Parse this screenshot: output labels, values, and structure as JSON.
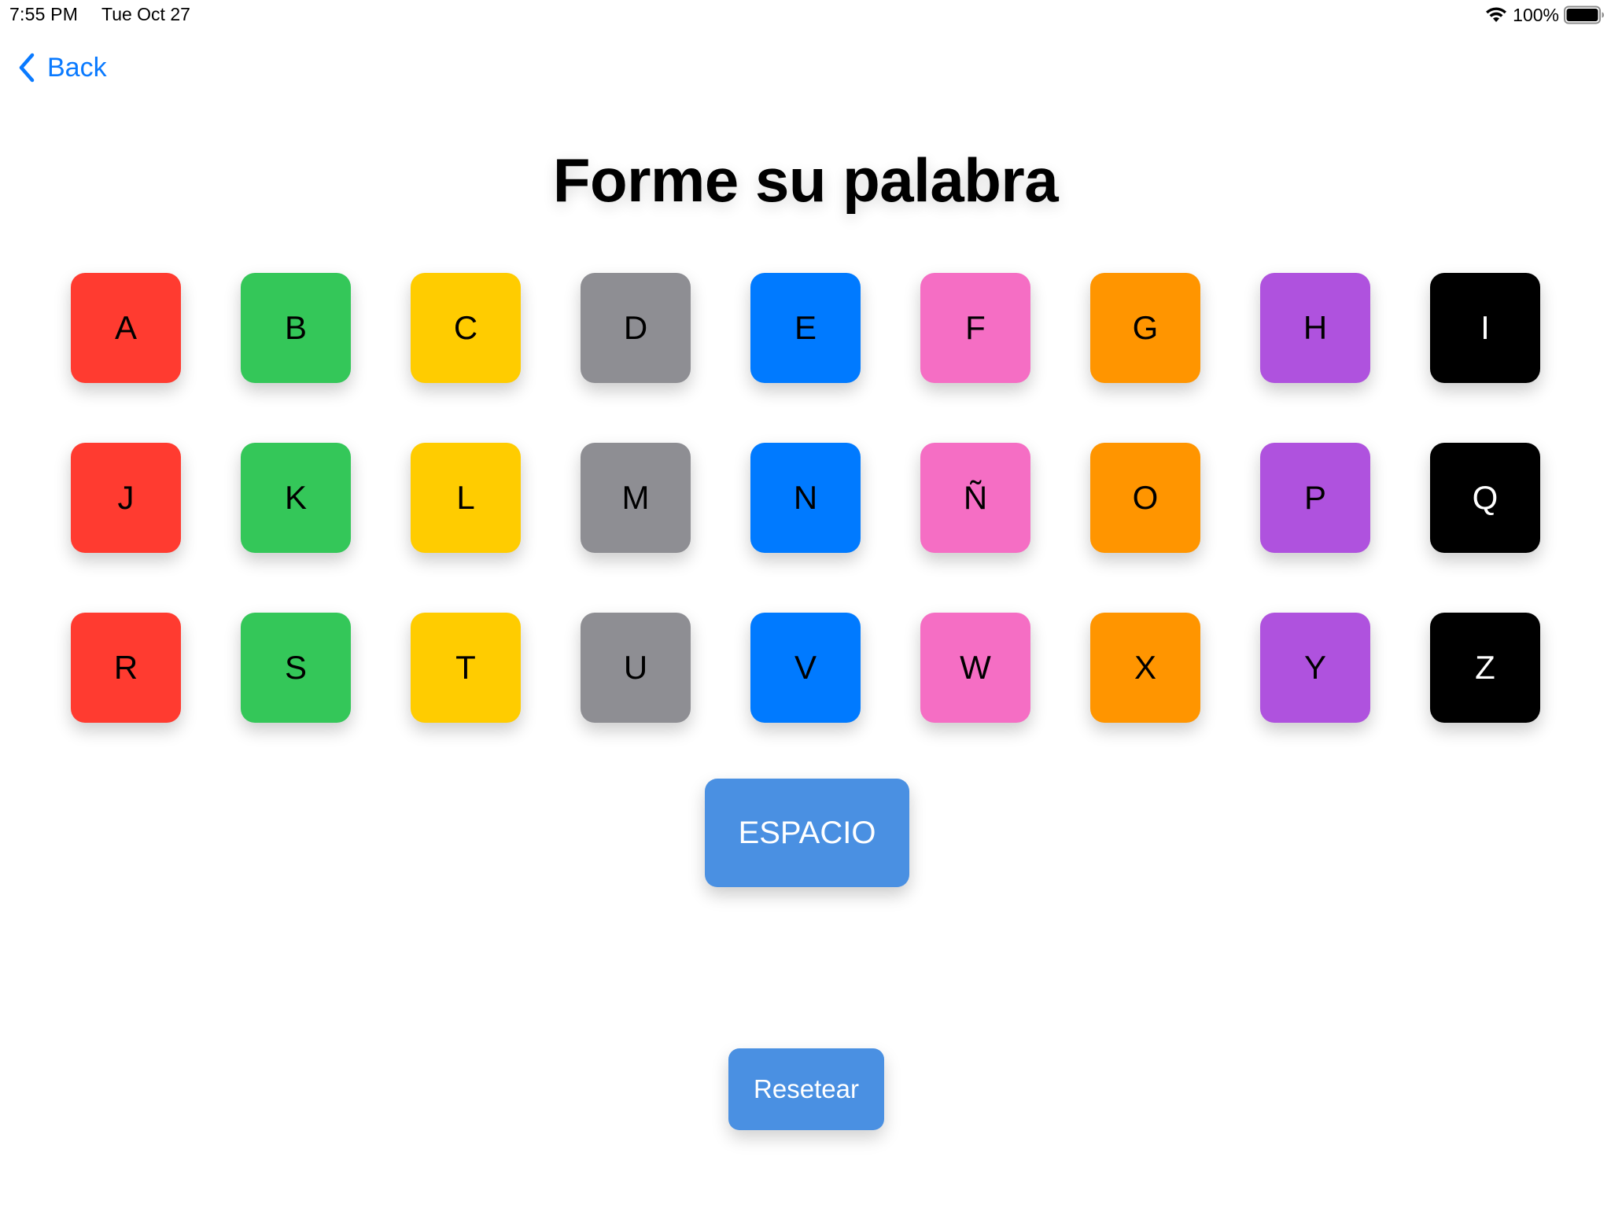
{
  "status_bar": {
    "time": "7:55 PM",
    "date": "Tue Oct 27",
    "battery_percent": "100%",
    "wifi_icon": "wifi-icon",
    "battery_icon": "battery-icon"
  },
  "nav": {
    "back_label": "Back",
    "back_icon": "chevron-left-icon"
  },
  "page": {
    "title": "Forme su palabra"
  },
  "colors": {
    "red": "#ff3b30",
    "green": "#34c759",
    "yellow": "#ffcc00",
    "gray": "#8e8e93",
    "blue": "#007aff",
    "pink": "#f56ec4",
    "orange": "#ff9500",
    "purple": "#af52de",
    "black": "#000000",
    "button_blue": "#4a90e2",
    "link_blue": "#0a7aff"
  },
  "keyboard": {
    "rows": [
      {
        "keys": [
          {
            "letter": "A",
            "color": "#ff3b30",
            "text_color": "#000000"
          },
          {
            "letter": "B",
            "color": "#34c759",
            "text_color": "#000000"
          },
          {
            "letter": "C",
            "color": "#ffcc00",
            "text_color": "#000000"
          },
          {
            "letter": "D",
            "color": "#8e8e93",
            "text_color": "#000000"
          },
          {
            "letter": "E",
            "color": "#007aff",
            "text_color": "#000000"
          },
          {
            "letter": "F",
            "color": "#f56ec4",
            "text_color": "#000000"
          },
          {
            "letter": "G",
            "color": "#ff9500",
            "text_color": "#000000"
          },
          {
            "letter": "H",
            "color": "#af52de",
            "text_color": "#000000"
          },
          {
            "letter": "I",
            "color": "#000000",
            "text_color": "#ffffff"
          }
        ]
      },
      {
        "keys": [
          {
            "letter": "J",
            "color": "#ff3b30",
            "text_color": "#000000"
          },
          {
            "letter": "K",
            "color": "#34c759",
            "text_color": "#000000"
          },
          {
            "letter": "L",
            "color": "#ffcc00",
            "text_color": "#000000"
          },
          {
            "letter": "M",
            "color": "#8e8e93",
            "text_color": "#000000"
          },
          {
            "letter": "N",
            "color": "#007aff",
            "text_color": "#000000"
          },
          {
            "letter": "Ñ",
            "color": "#f56ec4",
            "text_color": "#000000"
          },
          {
            "letter": "O",
            "color": "#ff9500",
            "text_color": "#000000"
          },
          {
            "letter": "P",
            "color": "#af52de",
            "text_color": "#000000"
          },
          {
            "letter": "Q",
            "color": "#000000",
            "text_color": "#ffffff"
          }
        ]
      },
      {
        "keys": [
          {
            "letter": "R",
            "color": "#ff3b30",
            "text_color": "#000000"
          },
          {
            "letter": "S",
            "color": "#34c759",
            "text_color": "#000000"
          },
          {
            "letter": "T",
            "color": "#ffcc00",
            "text_color": "#000000"
          },
          {
            "letter": "U",
            "color": "#8e8e93",
            "text_color": "#000000"
          },
          {
            "letter": "V",
            "color": "#007aff",
            "text_color": "#000000"
          },
          {
            "letter": "W",
            "color": "#f56ec4",
            "text_color": "#000000"
          },
          {
            "letter": "X",
            "color": "#ff9500",
            "text_color": "#000000"
          },
          {
            "letter": "Y",
            "color": "#af52de",
            "text_color": "#000000"
          },
          {
            "letter": "Z",
            "color": "#000000",
            "text_color": "#ffffff"
          }
        ]
      }
    ]
  },
  "actions": {
    "space_label": "ESPACIO",
    "reset_label": "Resetear"
  }
}
